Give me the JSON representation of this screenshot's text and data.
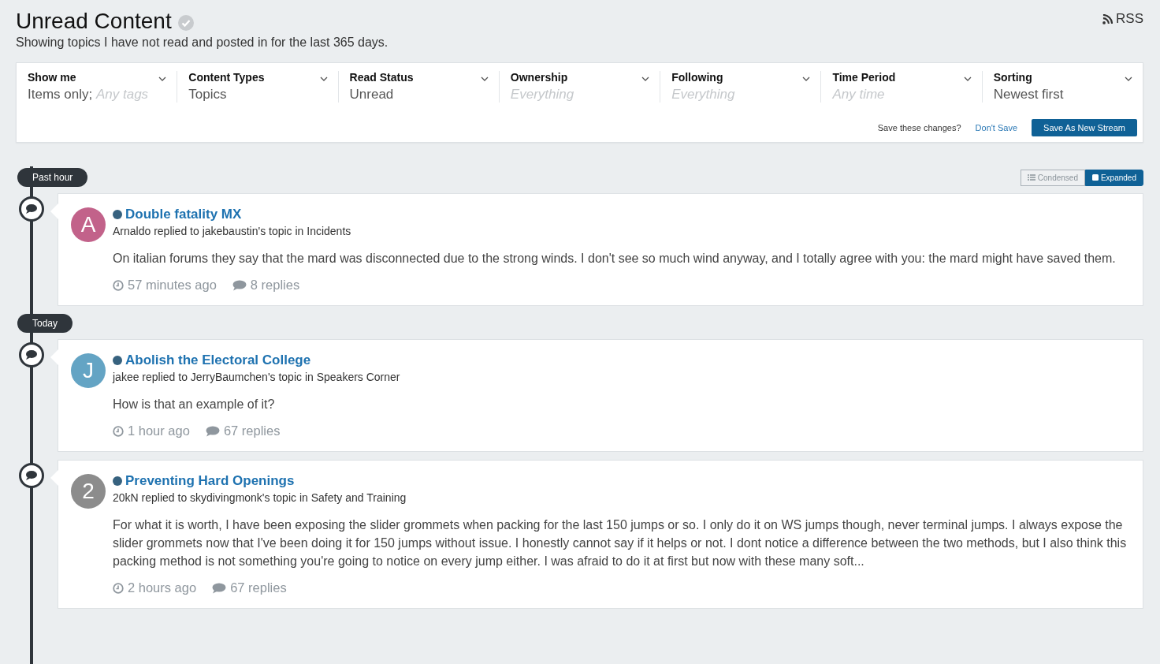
{
  "page": {
    "title": "Unread Content",
    "subtitle": "Showing topics I have not read and posted in for the last 365 days.",
    "rss": "RSS"
  },
  "filters": [
    {
      "label": "Show me",
      "value": [
        {
          "text": "Items only;",
          "default": false
        },
        {
          "text": "Any tags",
          "default": true
        }
      ]
    },
    {
      "label": "Content Types",
      "value": [
        {
          "text": "Topics",
          "default": false
        }
      ]
    },
    {
      "label": "Read Status",
      "value": [
        {
          "text": "Unread",
          "default": false
        }
      ]
    },
    {
      "label": "Ownership",
      "value": [
        {
          "text": "Everything",
          "default": true
        }
      ]
    },
    {
      "label": "Following",
      "value": [
        {
          "text": "Everything",
          "default": true
        }
      ]
    },
    {
      "label": "Time Period",
      "value": [
        {
          "text": "Any time",
          "default": true
        }
      ]
    },
    {
      "label": "Sorting",
      "value": [
        {
          "text": "Newest first",
          "default": false
        }
      ]
    }
  ],
  "save_bar": {
    "prompt": "Save these changes?",
    "dont_save": "Don't Save",
    "save": "Save As New Stream"
  },
  "view_toggle": [
    {
      "label": "Condensed",
      "kind": "condensed",
      "selected": false
    },
    {
      "label": "Expanded",
      "kind": "expanded",
      "selected": true
    }
  ],
  "groups": [
    {
      "label": "Past hour",
      "items": [
        {
          "avatar": "A",
          "color": "#c2628a",
          "title": "Double fatality MX",
          "unread": true,
          "meta": "Arnaldo replied to jakebaustin's topic in Incidents",
          "body": "On italian forums they say that the mard was disconnected due to the strong winds. I don't see so much wind anyway, and I totally agree with you: the mard might have saved them.",
          "time": "57 minutes ago",
          "replies": "8 replies"
        }
      ]
    },
    {
      "label": "Today",
      "items": [
        {
          "avatar": "J",
          "color": "#64a4c4",
          "title": "Abolish the Electoral College",
          "unread": true,
          "meta": "jakee replied to JerryBaumchen's topic in Speakers Corner",
          "body": "How is that an example of it?",
          "time": "1 hour ago",
          "replies": "67 replies"
        },
        {
          "avatar": "2",
          "color": "#8c8c8c",
          "title": "Preventing Hard Openings",
          "unread": true,
          "meta": "20kN replied to skydivingmonk's topic in Safety and Training",
          "body": "For what it is worth, I have been exposing the slider grommets when packing for the last 150 jumps or so. I only do it on WS jumps though, never terminal jumps. I always expose the slider grommets now that I've been doing it for 150 jumps without issue. I honestly cannot say if it helps or not. I dont notice a difference between the two methods, but I also think this packing method is not something you're going to notice on every jump either. I was afraid to do it at first but now with these many soft...",
          "time": "2 hours ago",
          "replies": "67 replies"
        }
      ]
    }
  ]
}
